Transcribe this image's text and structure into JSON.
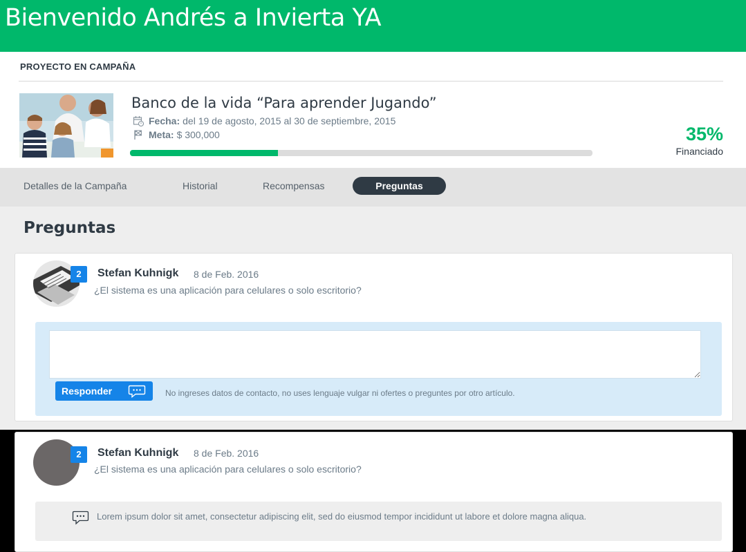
{
  "header": {
    "title": "Bienvenido Andrés a Invierta YA"
  },
  "project": {
    "section_label": "PROYECTO EN CAMPAÑA",
    "title": "Banco de la vida “Para aprender Jugando”",
    "fecha_label": "Fecha:",
    "fecha_value": "del 19 de agosto, 2015 al 30 de septiembre, 2015",
    "meta_label": "Meta:",
    "meta_value": "$ 300,000",
    "progress_fraction": 0.32,
    "percent": "35%",
    "funded_label": "Financiado"
  },
  "tabs": [
    {
      "label": "Detalles de la Campaña",
      "active": false
    },
    {
      "label": "Historial",
      "active": false
    },
    {
      "label": "Recompensas",
      "active": false
    },
    {
      "label": "Preguntas",
      "active": true
    }
  ],
  "page_title": "Preguntas",
  "questions": [
    {
      "badge": "2",
      "author": "Stefan Kuhnigk",
      "date": "8 de Feb. 2016",
      "text": "¿El sistema es una aplicación para celulares o solo escritorio?",
      "reply": {
        "button_label": "Responder",
        "hint": "No ingreses datos de contacto, no uses lenguaje vulgar ni ofertes o preguntes por otro artículo."
      }
    },
    {
      "badge": "2",
      "author": "Stefan Kuhnigk",
      "date": "8 de Feb. 2016",
      "text": "¿El sistema es una aplicación para celulares o solo escritorio?",
      "answer": "Lorem ipsum dolor sit amet, consectetur adipiscing elit, sed do eiusmod tempor incididunt ut labore et dolore magna aliqua."
    }
  ],
  "colors": {
    "brand_green": "#00b86b",
    "accent_blue": "#1584e8",
    "dark": "#2f3a44"
  },
  "icons": [
    "calendar-icon",
    "flag-icon",
    "chat-bubble-icon"
  ]
}
